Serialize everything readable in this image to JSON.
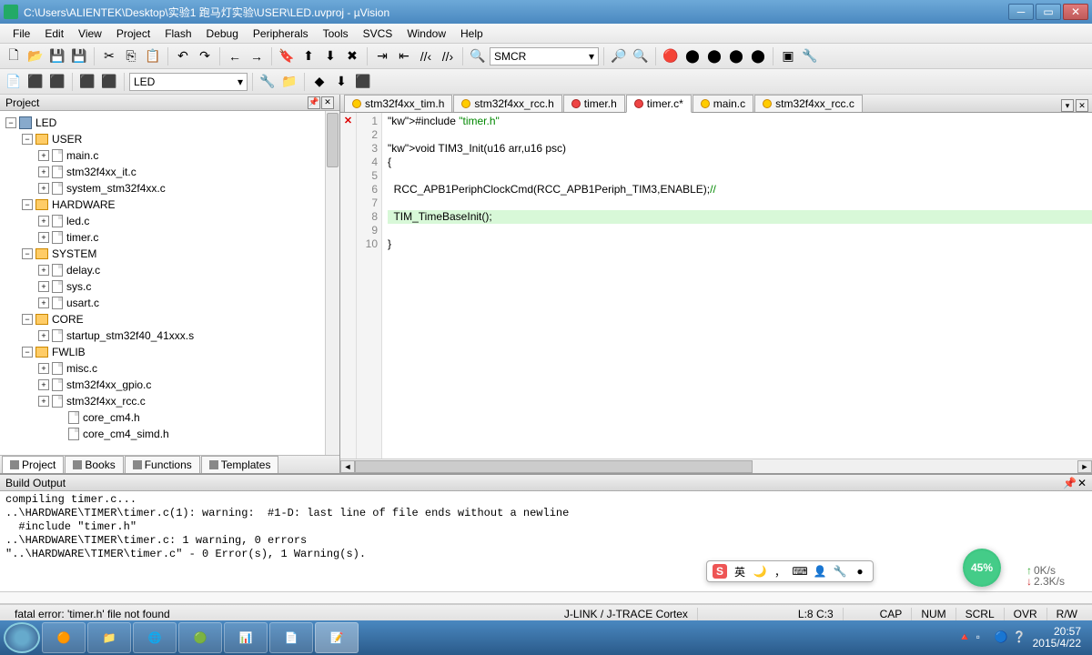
{
  "window": {
    "title": "C:\\Users\\ALIENTEK\\Desktop\\实验1 跑马灯实验\\USER\\LED.uvproj - µVision"
  },
  "menu": [
    "File",
    "Edit",
    "View",
    "Project",
    "Flash",
    "Debug",
    "Peripherals",
    "Tools",
    "SVCS",
    "Window",
    "Help"
  ],
  "toolbar1": {
    "find_combo": "SMCR"
  },
  "toolbar2": {
    "target_combo": "LED"
  },
  "project_panel": {
    "title": "Project",
    "root": "LED",
    "groups": [
      {
        "name": "USER",
        "files": [
          "main.c",
          "stm32f4xx_it.c",
          "system_stm32f4xx.c"
        ]
      },
      {
        "name": "HARDWARE",
        "files": [
          "led.c",
          "timer.c"
        ]
      },
      {
        "name": "SYSTEM",
        "files": [
          "delay.c",
          "sys.c",
          "usart.c"
        ]
      },
      {
        "name": "CORE",
        "files": [
          "startup_stm32f40_41xxx.s"
        ]
      },
      {
        "name": "FWLIB",
        "files": [
          "misc.c",
          "stm32f4xx_gpio.c",
          "stm32f4xx_rcc.c"
        ],
        "extra": [
          "core_cm4.h",
          "core_cm4_simd.h"
        ]
      }
    ],
    "tabs": [
      "Project",
      "Books",
      "Functions",
      "Templates"
    ]
  },
  "editor": {
    "tabs": [
      {
        "label": "stm32f4xx_tim.h",
        "color": "yellow"
      },
      {
        "label": "stm32f4xx_rcc.h",
        "color": "yellow"
      },
      {
        "label": "timer.h",
        "color": "red"
      },
      {
        "label": "timer.c*",
        "color": "red",
        "active": true
      },
      {
        "label": "main.c",
        "color": "yellow"
      },
      {
        "label": "stm32f4xx_rcc.c",
        "color": "yellow"
      }
    ],
    "lines": [
      "#include \"timer.h\"",
      "",
      "void TIM3_Init(u16 arr,u16 psc)",
      "{",
      "",
      "  RCC_APB1PeriphClockCmd(RCC_APB1Periph_TIM3,ENABLE);//",
      "",
      "  TIM_TimeBaseInit();",
      "",
      "}"
    ],
    "highlight_line": 8
  },
  "build": {
    "title": "Build Output",
    "text": "compiling timer.c...\n..\\HARDWARE\\TIMER\\timer.c(1): warning:  #1-D: last line of file ends without a newline\n  #include \"timer.h\"\n..\\HARDWARE\\TIMER\\timer.c: 1 warning, 0 errors\n\"..\\HARDWARE\\TIMER\\timer.c\" - 0 Error(s), 1 Warning(s)."
  },
  "status": {
    "left": "fatal error: 'timer.h' file not found",
    "mid": "J-LINK / J-TRACE Cortex",
    "pos": "L:8 C:3",
    "caps": "CAP",
    "num": "NUM",
    "scrl": "SCRL",
    "ovr": "OVR",
    "rw": "R/W"
  },
  "ime": {
    "lang": "英"
  },
  "meter": {
    "pct": "45%"
  },
  "net": {
    "up": "0K/s",
    "down": "2.3K/s"
  },
  "clock": {
    "time": "20:57",
    "date": "2015/4/22"
  }
}
